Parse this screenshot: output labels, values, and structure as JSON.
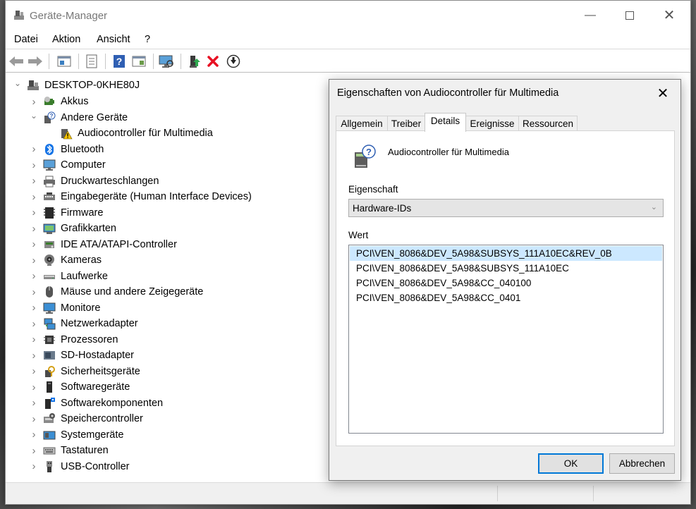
{
  "window": {
    "title": "Geräte-Manager"
  },
  "menu": [
    "Datei",
    "Aktion",
    "Ansicht",
    "?"
  ],
  "tree": {
    "root": "DESKTOP-0KHE80J",
    "items": [
      {
        "label": "Akkus",
        "icon": "battery-icon",
        "expanded": false
      },
      {
        "label": "Andere Geräte",
        "icon": "unknown-device-icon",
        "expanded": true
      },
      {
        "label": "Audiocontroller für Multimedia",
        "icon": "warning-device-icon",
        "child": true
      },
      {
        "label": "Bluetooth",
        "icon": "bluetooth-icon",
        "expanded": false
      },
      {
        "label": "Computer",
        "icon": "computer-icon",
        "expanded": false
      },
      {
        "label": "Druckwarteschlangen",
        "icon": "printer-icon",
        "expanded": false
      },
      {
        "label": "Eingabegeräte (Human Interface Devices)",
        "icon": "hid-icon",
        "expanded": false
      },
      {
        "label": "Firmware",
        "icon": "firmware-icon",
        "expanded": false
      },
      {
        "label": "Grafikkarten",
        "icon": "display-adapter-icon",
        "expanded": false
      },
      {
        "label": "IDE ATA/ATAPI-Controller",
        "icon": "ide-controller-icon",
        "expanded": false
      },
      {
        "label": "Kameras",
        "icon": "camera-icon",
        "expanded": false
      },
      {
        "label": "Laufwerke",
        "icon": "disk-drive-icon",
        "expanded": false
      },
      {
        "label": "Mäuse und andere Zeigegeräte",
        "icon": "mouse-icon",
        "expanded": false
      },
      {
        "label": "Monitore",
        "icon": "monitor-icon",
        "expanded": false
      },
      {
        "label": "Netzwerkadapter",
        "icon": "network-adapter-icon",
        "expanded": false
      },
      {
        "label": "Prozessoren",
        "icon": "processor-icon",
        "expanded": false
      },
      {
        "label": "SD-Hostadapter",
        "icon": "sd-host-icon",
        "expanded": false
      },
      {
        "label": "Sicherheitsgeräte",
        "icon": "security-device-icon",
        "expanded": false
      },
      {
        "label": "Softwaregeräte",
        "icon": "software-device-icon",
        "expanded": false
      },
      {
        "label": "Softwarekomponenten",
        "icon": "software-component-icon",
        "expanded": false
      },
      {
        "label": "Speichercontroller",
        "icon": "storage-controller-icon",
        "expanded": false
      },
      {
        "label": "Systemgeräte",
        "icon": "system-device-icon",
        "expanded": false
      },
      {
        "label": "Tastaturen",
        "icon": "keyboard-icon",
        "expanded": false
      },
      {
        "label": "USB-Controller",
        "icon": "usb-icon",
        "expanded": false
      }
    ]
  },
  "dialog": {
    "title": "Eigenschaften von Audiocontroller für Multimedia",
    "tabs": [
      "Allgemein",
      "Treiber",
      "Details",
      "Ereignisse",
      "Ressourcen"
    ],
    "active_tab": "Details",
    "device_name": "Audiocontroller für Multimedia",
    "property_label": "Eigenschaft",
    "property_value": "Hardware-IDs",
    "value_label": "Wert",
    "values": [
      "PCI\\VEN_8086&DEV_5A98&SUBSYS_111A10EC&REV_0B",
      "PCI\\VEN_8086&DEV_5A98&SUBSYS_111A10EC",
      "PCI\\VEN_8086&DEV_5A98&CC_040100",
      "PCI\\VEN_8086&DEV_5A98&CC_0401"
    ],
    "ok_label": "OK",
    "cancel_label": "Abbrechen"
  },
  "colors": {
    "selection": "#cce8ff",
    "accent": "#0078d7",
    "warning": "#f5c400",
    "delete": "#e81123"
  }
}
